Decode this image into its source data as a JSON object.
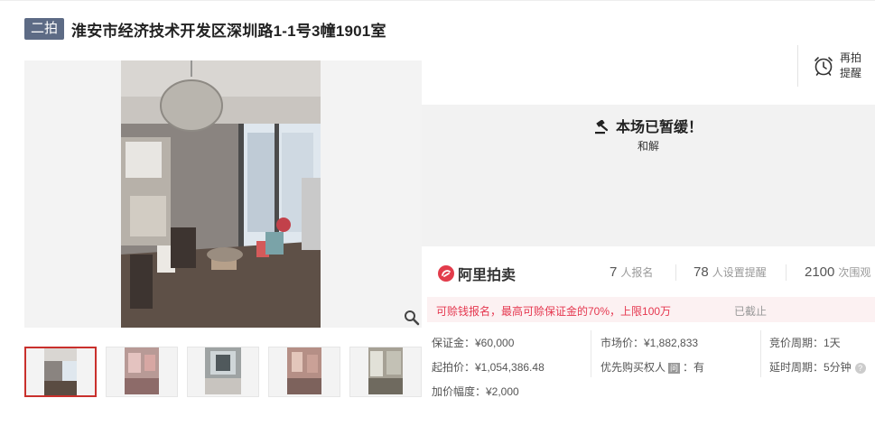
{
  "header": {
    "badge": "二拍",
    "title": "淮安市经济技术开发区深圳路1-1号3幢1901室"
  },
  "reminder": {
    "label": "再拍提醒"
  },
  "status": {
    "title": "本场已暂缓！",
    "reason": "和解"
  },
  "brand": {
    "logo_text": "阿里拍卖"
  },
  "stats": [
    {
      "value": "7",
      "label": "人报名"
    },
    {
      "value": "78",
      "label": "人设置提醒"
    },
    {
      "value": "2100",
      "label": "次围观"
    }
  ],
  "notice": {
    "text": "可赊钱报名，最高可赊保证金的70%，上限100万",
    "status": "已截止"
  },
  "info": {
    "deposit": "保证金：¥60,000",
    "start_price": "起拍价：¥1,054,386.48",
    "increment": "加价幅度：¥2,000",
    "market_price": "市场价：¥1,882,833",
    "priority_label": "优先购买权人",
    "priority_tag": "问",
    "priority_value": "：有",
    "cycle": "竞价周期：1天",
    "delay": "延时周期：5分钟",
    "delay_help": "?"
  },
  "colors": {
    "badge_bg": "#5d6b85",
    "active_thumb_border": "#c9302c",
    "notice_text": "#e5374f",
    "notice_bg": "#fcf1f2",
    "status_bg": "#f2f2f2",
    "brand_red": "#e23c4b"
  },
  "icons": {
    "reminder": "alarm-clock-icon",
    "status": "gavel-icon",
    "zoom": "magnifier-icon",
    "logo": "ali-auction-logo"
  }
}
